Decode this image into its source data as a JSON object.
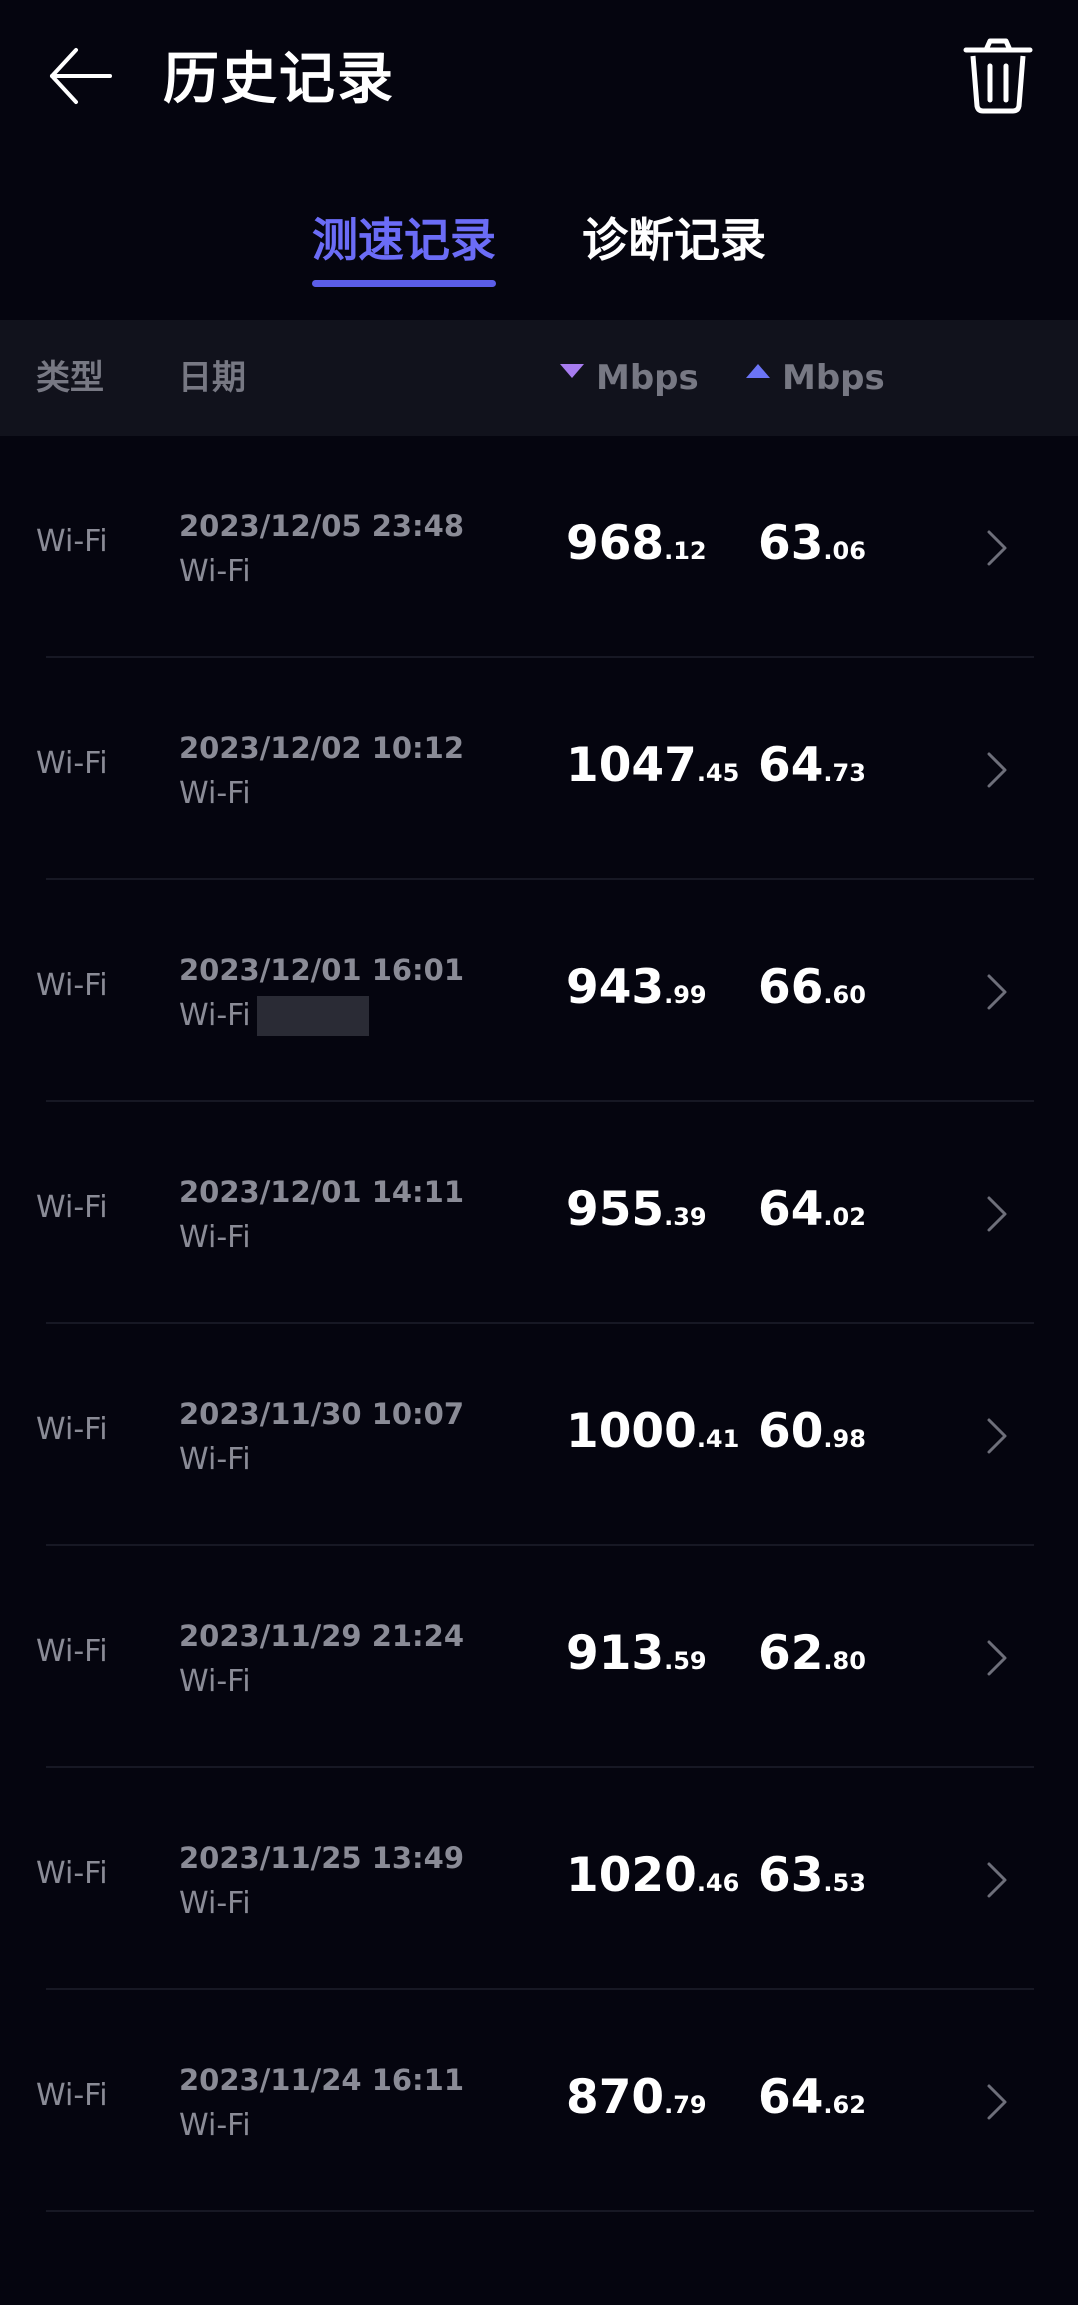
{
  "header": {
    "title": "历史记录",
    "back_icon": "arrow-left-icon",
    "trash_icon": "trash-icon"
  },
  "tabs": [
    {
      "label": "测速记录",
      "active": true
    },
    {
      "label": "诊断记录",
      "active": false
    }
  ],
  "columns": {
    "type": "类型",
    "date": "日期",
    "download_unit": "Mbps",
    "upload_unit": "Mbps"
  },
  "colors": {
    "background": "#05050f",
    "accent": "#6b6cf6",
    "download_arrow": "#a77cf0",
    "upload_arrow": "#6b74f6",
    "muted_text": "#8a8b96"
  },
  "records": [
    {
      "type": "Wi-Fi",
      "date": "2023/12/05 23:48",
      "network": "Wi-Fi",
      "down_int": "968",
      "down_dec": ".12",
      "up_int": "63",
      "up_dec": ".06",
      "redacted": false
    },
    {
      "type": "Wi-Fi",
      "date": "2023/12/02 10:12",
      "network": "Wi-Fi",
      "down_int": "1047",
      "down_dec": ".45",
      "up_int": "64",
      "up_dec": ".73",
      "redacted": false
    },
    {
      "type": "Wi-Fi",
      "date": "2023/12/01 16:01",
      "network": "Wi-Fi",
      "down_int": "943",
      "down_dec": ".99",
      "up_int": "66",
      "up_dec": ".60",
      "redacted": true
    },
    {
      "type": "Wi-Fi",
      "date": "2023/12/01 14:11",
      "network": "Wi-Fi",
      "down_int": "955",
      "down_dec": ".39",
      "up_int": "64",
      "up_dec": ".02",
      "redacted": false
    },
    {
      "type": "Wi-Fi",
      "date": "2023/11/30 10:07",
      "network": "Wi-Fi",
      "down_int": "1000",
      "down_dec": ".41",
      "up_int": "60",
      "up_dec": ".98",
      "redacted": false
    },
    {
      "type": "Wi-Fi",
      "date": "2023/11/29 21:24",
      "network": "Wi-Fi",
      "down_int": "913",
      "down_dec": ".59",
      "up_int": "62",
      "up_dec": ".80",
      "redacted": false
    },
    {
      "type": "Wi-Fi",
      "date": "2023/11/25 13:49",
      "network": "Wi-Fi",
      "down_int": "1020",
      "down_dec": ".46",
      "up_int": "63",
      "up_dec": ".53",
      "redacted": false
    },
    {
      "type": "Wi-Fi",
      "date": "2023/11/24 16:11",
      "network": "Wi-Fi",
      "down_int": "870",
      "down_dec": ".79",
      "up_int": "64",
      "up_dec": ".62",
      "redacted": false
    }
  ]
}
